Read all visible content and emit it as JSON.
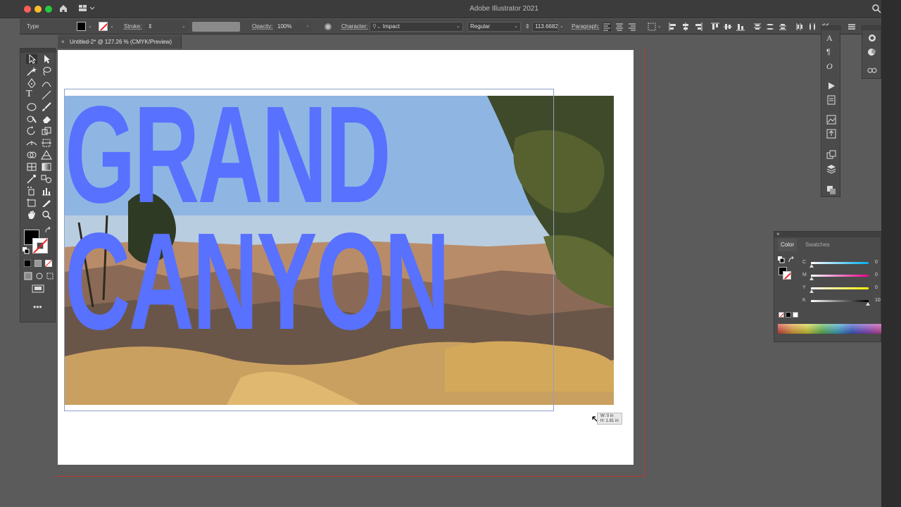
{
  "window": {
    "title": "Adobe Illustrator 2021"
  },
  "control_bar": {
    "mode_label": "Type",
    "stroke_label": "Stroke:",
    "opacity_label": "Opacity:",
    "opacity_value": "100%",
    "character_label": "Character:",
    "font_family": "Impact",
    "font_style": "Regular",
    "font_size": "113.6682",
    "paragraph_label": "Paragraph:"
  },
  "document": {
    "tab_label": "Untitled-2* @ 127.26 % (CMYK/Preview)"
  },
  "artwork": {
    "headline_line1": "GRAND",
    "headline_line2": "CANYON",
    "headline_color": "#5871ff",
    "size_tooltip_w": "W: 0 in",
    "size_tooltip_h": "H: 1.81 in"
  },
  "color_panel": {
    "tab_color": "Color",
    "tab_swatches": "Swatches",
    "sliders": [
      {
        "label": "C",
        "value": "0"
      },
      {
        "label": "M",
        "value": "0"
      },
      {
        "label": "Y",
        "value": "0"
      },
      {
        "label": "K",
        "value": "10"
      }
    ]
  },
  "colors": {
    "bleed_guide": "#c0392b",
    "fill": "#000000"
  },
  "toolbar": {
    "more_label": "•••"
  }
}
